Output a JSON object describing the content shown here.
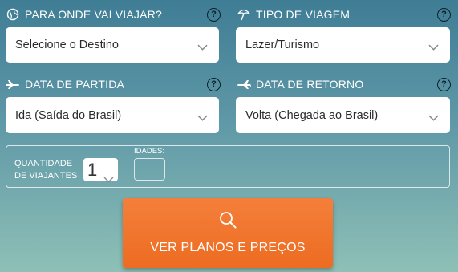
{
  "destination": {
    "label": "PARA ONDE VAI VIAJAR?",
    "icon": "globe-icon",
    "value": "Selecione o Destino",
    "help": "?"
  },
  "trip_type": {
    "label": "TIPO DE VIAGEM",
    "icon": "beach-umbrella-icon",
    "value": "Lazer/Turismo",
    "help": "?"
  },
  "departure": {
    "label": "DATA DE PARTIDA",
    "icon": "plane-departure-icon",
    "value": "Ida (Saída do Brasil)",
    "help": "?"
  },
  "return": {
    "label": "DATA DE RETORNO",
    "icon": "plane-return-icon",
    "value": "Volta (Chegada ao Brasil)",
    "help": "?"
  },
  "travelers": {
    "label_line1": "QUANTIDADE",
    "label_line2": "DE VIAJANTES",
    "quantity": "1",
    "ages_label": "IDADES:"
  },
  "cta": {
    "label": "VER PLANOS E PREÇOS",
    "icon": "search-icon"
  },
  "colors": {
    "accent": "#ef7126",
    "background_top": "#3f7d95",
    "background_bottom": "#8ec0b6"
  }
}
